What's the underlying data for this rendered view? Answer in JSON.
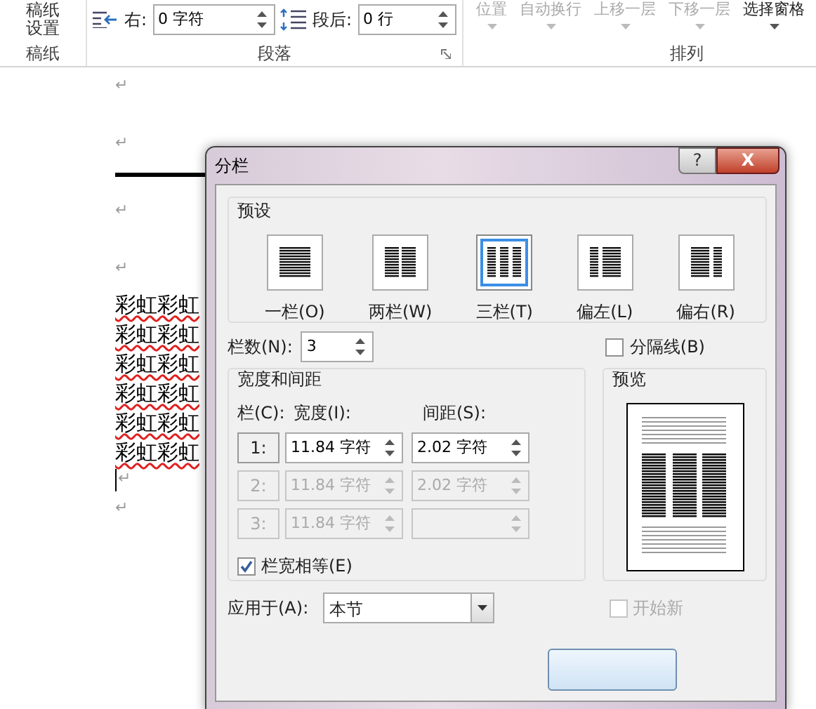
{
  "ribbon": {
    "paper_button": [
      "稿纸",
      "设置"
    ],
    "indent_right": {
      "label": "右:",
      "value": "0 字符"
    },
    "spacing_after": {
      "label": "段后:",
      "value": "0 行"
    },
    "arrange_buttons": [
      {
        "label": "位置",
        "disabled": true
      },
      {
        "label": "自动换行",
        "disabled": true
      },
      {
        "label": "上移一层",
        "disabled": true
      },
      {
        "label": "下移一层",
        "disabled": true
      },
      {
        "label": "选择窗格",
        "disabled": false
      }
    ],
    "groups": [
      "稿纸",
      "段落",
      "排列"
    ]
  },
  "document": {
    "lines": [
      {
        "kind": "para",
        "text": "↵"
      },
      {
        "kind": "mark",
        "text": "↵"
      },
      {
        "kind": "rule"
      },
      {
        "kind": "para",
        "text": "↵"
      },
      {
        "kind": "mark",
        "text": "↵"
      },
      {
        "kind": "text",
        "text": "彩虹彩虹"
      },
      {
        "kind": "text",
        "text": "彩虹彩虹"
      },
      {
        "kind": "text",
        "text": "彩虹彩虹"
      },
      {
        "kind": "text",
        "text": "彩虹彩虹"
      },
      {
        "kind": "text",
        "text": "彩虹彩虹"
      },
      {
        "kind": "text",
        "text": "彩虹彩虹"
      },
      {
        "kind": "cursor",
        "text": "↵"
      },
      {
        "kind": "mark",
        "text": "↵"
      }
    ]
  },
  "dialog": {
    "title": "分栏",
    "help": "?",
    "close": "X",
    "presets_title": "预设",
    "presets": [
      {
        "kind": "one",
        "label": "一栏(O)",
        "selected": false
      },
      {
        "kind": "two",
        "label": "两栏(W)",
        "selected": false
      },
      {
        "kind": "three",
        "label": "三栏(T)",
        "selected": true
      },
      {
        "kind": "left",
        "label": "偏左(L)",
        "selected": false
      },
      {
        "kind": "right",
        "label": "偏右(R)",
        "selected": false
      }
    ],
    "count_label": "栏数(N):",
    "count_value": "3",
    "separator": {
      "label": "分隔线(B)",
      "checked": false,
      "disabled": false
    },
    "width_group_title": "宽度和间距",
    "headers": [
      "栏(C):",
      "宽度(I):",
      "间距(S):"
    ],
    "rows": [
      {
        "index": "1:",
        "width": "11.84 字符",
        "spacing": "2.02 字符",
        "disabled": false
      },
      {
        "index": "2:",
        "width": "11.84 字符",
        "spacing": "2.02 字符",
        "disabled": true
      },
      {
        "index": "3:",
        "width": "11.84 字符",
        "disabled": true
      }
    ],
    "equal_width": {
      "label": "栏宽相等(E)",
      "checked": true,
      "disabled": false
    },
    "preview_title": "预览",
    "apply_label": "应用于(A):",
    "apply_value": "本节",
    "new_column": {
      "label": "开始新",
      "checked": false,
      "disabled": true
    }
  }
}
